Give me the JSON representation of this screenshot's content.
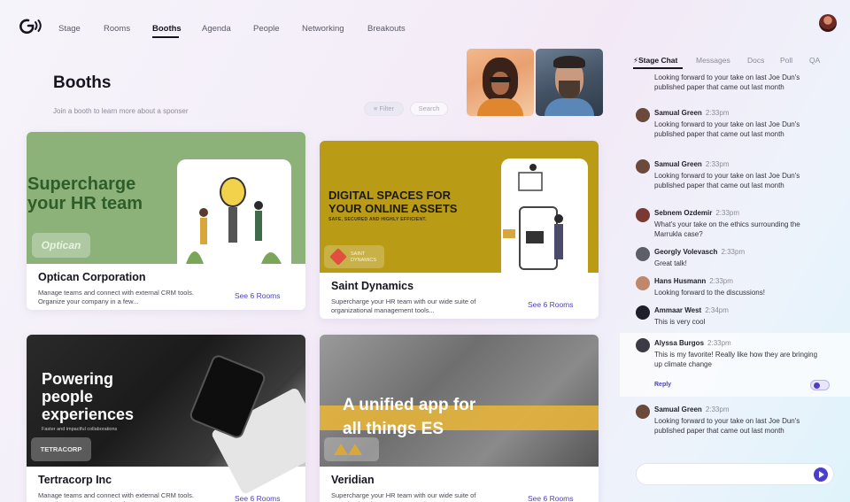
{
  "nav": {
    "items": [
      "Stage",
      "Rooms",
      "Booths",
      "Agenda",
      "People",
      "Networking",
      "Breakouts"
    ],
    "active": "Booths"
  },
  "page": {
    "title": "Booths",
    "subtitle": "Join a booth to learn more about a sponser",
    "filter_label": "Filter",
    "search_placeholder": "Search"
  },
  "booths": [
    {
      "name": "Optican Corporation",
      "description": "Manage teams and connect with external CRM tools. Organize your company in a few...",
      "link": "See 6 Rooms",
      "hero": "Supercharge your HR team",
      "brand": "Optican"
    },
    {
      "name": "Saint Dynamics",
      "description": "Supercharge your HR team with our wide suite of organizational management tools...",
      "link": "See 6 Rooms",
      "hero": "DIGITAL SPACES FOR YOUR ONLINE ASSETS",
      "hero_small": "SAFE, SECURED AND HIGHLY EFFICIENT.",
      "brand": "SAINT DYNAMICS"
    },
    {
      "name": "Tertracorp Inc",
      "description": "Manage teams and connect with external CRM tools. Organize your company in a few...",
      "link": "See 6 Rooms",
      "hero": "Powering people experiences",
      "hero_small": "Faster and impactful collaborations",
      "brand": "TETRACORP"
    },
    {
      "name": "Veridian",
      "description": "Supercharge your HR team with our wide suite of organizational management tools...",
      "link": "See 6 Rooms",
      "hero": "A unified app for all things    ES"
    }
  ],
  "chat": {
    "tabs": [
      "Stage Chat",
      "Messages",
      "Docs",
      "Poll",
      "QA"
    ],
    "active_tab": "Stage Chat",
    "partial_message": "Looking forward to your take on last Joe Dun's published paper that came out last month",
    "messages": [
      {
        "name": "Samual Green",
        "time": "2:33pm",
        "text": "Looking forward to your take on last Joe Dun's published paper that came out last month"
      },
      {
        "name": "Samual Green",
        "time": "2:33pm",
        "text": "Looking forward to your take on last Joe Dun's published paper that came out last month"
      },
      {
        "name": "Sebnem Ozdemir",
        "time": "2:33pm",
        "text": "What's your take on the ethics surrounding the Marrukla case?"
      },
      {
        "name": "Georgly Volevasch",
        "time": "2:33pm",
        "text": "Great talk!"
      },
      {
        "name": "Hans Husmann",
        "time": "2:33pm",
        "text": "Looking forward to the discussions!"
      },
      {
        "name": "Ammaar West",
        "time": "2:34pm",
        "text": "This is very cool"
      },
      {
        "name": "Alyssa Burgos",
        "time": "2:33pm",
        "text": "This is my favorite! Really like how they are bringing up climate change"
      },
      {
        "name": "Samual Green",
        "time": "2:33pm",
        "text": "Looking forward to your take on last Joe Dun's published paper that came out last month"
      }
    ],
    "reply_label": "Reply"
  }
}
